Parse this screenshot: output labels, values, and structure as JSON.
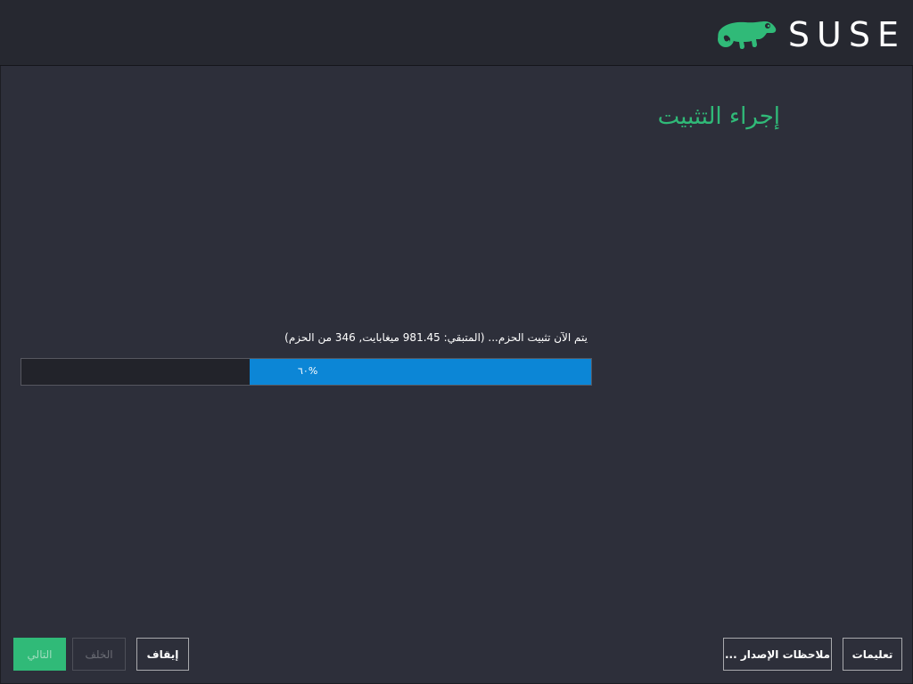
{
  "header": {
    "brand_text": "SUSE",
    "logo_icon": "chameleon-icon",
    "brand_color": "#30ba78"
  },
  "main": {
    "title": "إجراء التثبيت",
    "status_text": "يتم الآن تثبيت الحزم... (المتبقي: 981.45 ميغابايت, 346 من الحزم)",
    "progress": {
      "percent": 60,
      "label": "٦٠%",
      "fill_color": "#0c86d6"
    }
  },
  "footer": {
    "next_label": "التالي",
    "back_label": "الخلف",
    "abort_label": "إيقاف",
    "release_notes_label": "ملاحظات الإصدار ...",
    "help_label": "تعليمات"
  }
}
